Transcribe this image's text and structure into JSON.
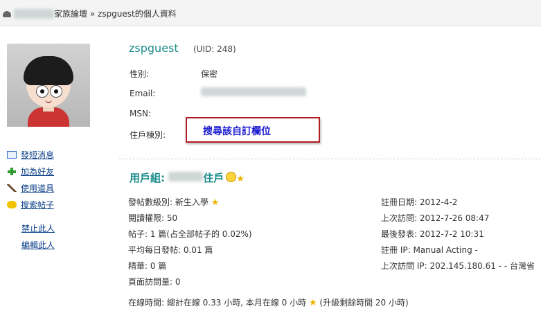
{
  "breadcrumb": {
    "forum_name": "家族論壇",
    "separator": "»",
    "current": "zspguest的個人資料"
  },
  "sidebar": {
    "items": [
      {
        "label": "發短消息",
        "icon": "envelope-icon"
      },
      {
        "label": "加為好友",
        "icon": "plus-icon"
      },
      {
        "label": "使用道具",
        "icon": "magic-wand-icon"
      },
      {
        "label": "搜索帖子",
        "icon": "speech-bubble-icon"
      }
    ],
    "admin": [
      {
        "label": "禁止此人"
      },
      {
        "label": "編輯此人"
      }
    ]
  },
  "profile": {
    "username": "zspguest",
    "uid": "(UID: 248)",
    "gender_label": "性別:",
    "gender_value": "保密",
    "email_label": "Email:",
    "msn_label": "MSN:",
    "custom_label": "住戶棟別:"
  },
  "callout": {
    "text": "搜尋該自訂欄位"
  },
  "group": {
    "prefix": "用戶組:",
    "suffix": "住戶"
  },
  "stats_left": [
    {
      "text": "發帖數級別: 新生入學"
    },
    {
      "text": "閱讀權限: 50"
    },
    {
      "text": "帖子: 1 篇(占全部帖子的 0.02%)"
    },
    {
      "text": "平均每日發帖: 0.01 篇"
    },
    {
      "text": "精華: 0 篇"
    },
    {
      "text": "頁面訪問量: 0"
    }
  ],
  "stats_right": [
    {
      "text": "註冊日期: 2012-4-2"
    },
    {
      "text": "上次訪問: 2012-7-26 08:47"
    },
    {
      "text": "最後發表: 2012-7-2 10:31"
    },
    {
      "text": "註冊 IP: Manual Acting -"
    },
    {
      "text": "上次訪問 IP: 202.145.180.61 - - 台灣省"
    }
  ],
  "online": {
    "before": "在線時間: 總計在線 0.33 小時, 本月在線 0 小時",
    "after": "(升級剩餘時間 20 小時)"
  },
  "colors": {
    "accent": "#1a8c8a",
    "link": "#0a3f8a",
    "callout_border": "#b21d24",
    "callout_text": "#1b1bd0"
  }
}
